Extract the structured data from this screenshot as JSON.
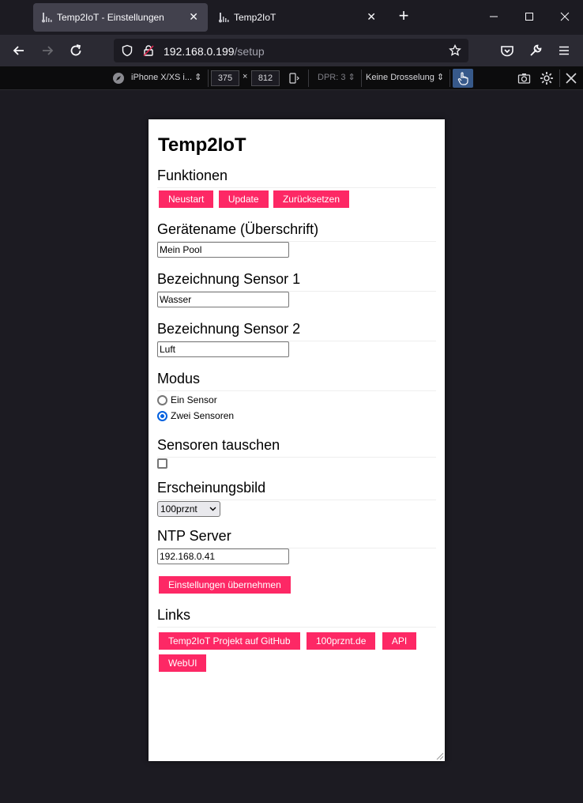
{
  "browser": {
    "tabs": [
      {
        "title": "Temp2IoT - Einstellungen",
        "active": true
      },
      {
        "title": "Temp2IoT",
        "active": false
      }
    ],
    "url": {
      "host": "192.168.0.199",
      "path": "/setup"
    }
  },
  "rdm": {
    "device": "iPhone X/XS i...",
    "width": "375",
    "times": "×",
    "height": "812",
    "dpr": "DPR: 3",
    "throttling": "Keine Drosselung"
  },
  "page": {
    "title": "Temp2IoT",
    "functions": {
      "heading": "Funktionen",
      "buttons": [
        "Neustart",
        "Update",
        "Zurücksetzen"
      ]
    },
    "device_name": {
      "heading": "Gerätename (Überschrift)",
      "value": "Mein Pool"
    },
    "sensor1": {
      "heading": "Bezeichnung Sensor 1",
      "value": "Wasser"
    },
    "sensor2": {
      "heading": "Bezeichnung Sensor 2",
      "value": "Luft"
    },
    "mode": {
      "heading": "Modus",
      "options": [
        {
          "label": "Ein Sensor",
          "checked": false
        },
        {
          "label": "Zwei Sensoren",
          "checked": true
        }
      ]
    },
    "swap": {
      "heading": "Sensoren tauschen",
      "checked": false
    },
    "appearance": {
      "heading": "Erscheinungsbild",
      "selected": "100prznt"
    },
    "ntp": {
      "heading": "NTP Server",
      "value": "192.168.0.41"
    },
    "apply_label": "Einstellungen übernehmen",
    "links": {
      "heading": "Links",
      "items": [
        "Temp2IoT Projekt auf GitHub",
        "100prznt.de",
        "API",
        "WebUI"
      ]
    }
  },
  "colors": {
    "accent": "#fd2865",
    "radio_accent": "#0060df"
  }
}
